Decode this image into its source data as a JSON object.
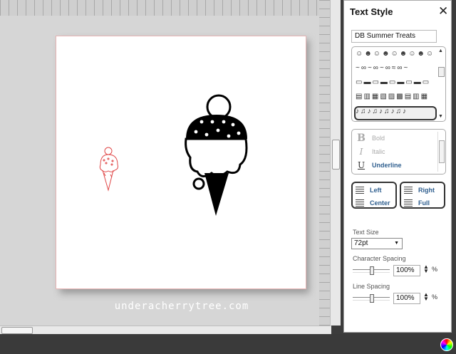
{
  "canvas": {
    "watermark": "underacherrytree.com"
  },
  "panel": {
    "title": "Text Style",
    "font_name": "DB Summer Treats",
    "glyph_rows": [
      "☺☻☺☻☺☻☺☻☺",
      "~∞~∞~∞≈∞~",
      "▭▬▭▬▭▬▭▬▭",
      "▤▥▦▧▨▩▤▥▦",
      "♪♫♪♫♪♫♪♫♪"
    ],
    "styles": [
      {
        "icon": "B",
        "label": "Bold"
      },
      {
        "icon": "I",
        "label": "Italic"
      },
      {
        "icon": "U",
        "label": "Underline"
      }
    ],
    "align": {
      "left": "Left",
      "center": "Center",
      "right": "Right",
      "full": "Full"
    },
    "text_size_label": "Text Size",
    "text_size_value": "72pt",
    "char_spacing_label": "Character Spacing",
    "char_spacing_value": "100%",
    "line_spacing_label": "Line Spacing",
    "line_spacing_value": "100%",
    "percent_sign": "%"
  },
  "colors": {
    "selected_outline": "#e04848",
    "shape": "#000000"
  },
  "icons": {
    "close": "close-icon",
    "color_wheel": "color-wheel-icon"
  }
}
